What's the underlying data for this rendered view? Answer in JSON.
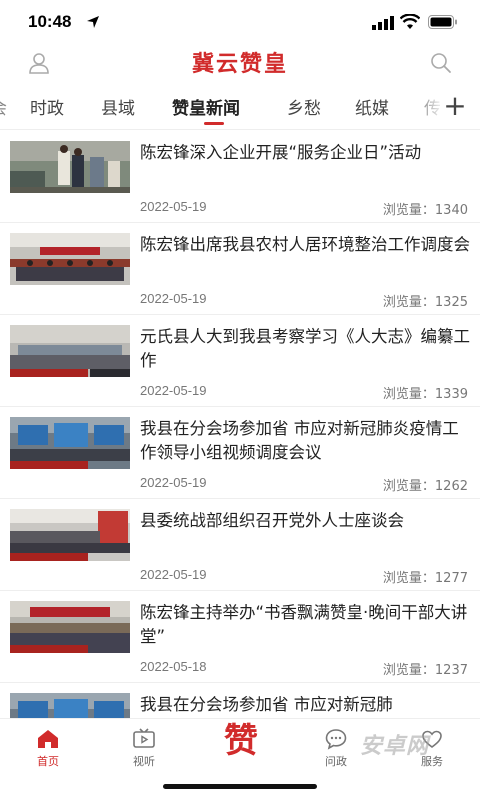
{
  "status": {
    "time": "10:48"
  },
  "header": {
    "title": "冀云赞皇"
  },
  "tabs": [
    {
      "label": "时政"
    },
    {
      "label": "县域"
    },
    {
      "label": "赞皇新闻"
    },
    {
      "label": "乡愁"
    },
    {
      "label": "纸媒"
    },
    {
      "label": "+"
    }
  ],
  "articles": [
    {
      "title": "陈宏锋深入企业开展“服务企业日”活动",
      "date": "2022-05-19",
      "views": "浏览量：1340"
    },
    {
      "title": "陈宏锋出席我县农村人居环境整治工作调度会",
      "date": "2022-05-19",
      "views": "浏览量：1325"
    },
    {
      "title": "元氏县人大到我县考察学习《人大志》编纂工作",
      "date": "2022-05-19",
      "views": "浏览量：1339"
    },
    {
      "title": "我县在分会场参加省 市应对新冠肺炎疫情工作领导小组视频调度会议",
      "date": "2022-05-19",
      "views": "浏览量：1262"
    },
    {
      "title": "县委统战部组织召开党外人士座谈会",
      "date": "2022-05-19",
      "views": "浏览量：1277"
    },
    {
      "title": "陈宏锋主持举办“书香飘满赞皇·晚间干部大讲堂”",
      "date": "2022-05-18",
      "views": "浏览量：1237"
    },
    {
      "title": "我县在分会场参加省 市应对新冠肺",
      "date": "",
      "views": ""
    }
  ],
  "nav": {
    "home": "首页",
    "video": "视听",
    "center": "赞",
    "ask": "问政",
    "service": "服务"
  },
  "watermark": "安卓网",
  "colors": {
    "accent": "#d12b2b"
  }
}
